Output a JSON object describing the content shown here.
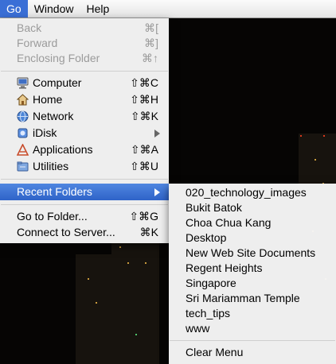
{
  "menubar": {
    "items": [
      {
        "label": "Go"
      },
      {
        "label": "Window"
      },
      {
        "label": "Help"
      }
    ]
  },
  "go_menu": {
    "back": {
      "label": "Back",
      "key": "⌘["
    },
    "forward": {
      "label": "Forward",
      "key": "⌘]"
    },
    "enclosing": {
      "label": "Enclosing Folder",
      "key": "⌘↑"
    },
    "computer": {
      "label": "Computer",
      "key": "⇧⌘C"
    },
    "home": {
      "label": "Home",
      "key": "⇧⌘H"
    },
    "network": {
      "label": "Network",
      "key": "⇧⌘K"
    },
    "idisk": {
      "label": "iDisk"
    },
    "applications": {
      "label": "Applications",
      "key": "⇧⌘A"
    },
    "utilities": {
      "label": "Utilities",
      "key": "⇧⌘U"
    },
    "recent": {
      "label": "Recent Folders"
    },
    "goto": {
      "label": "Go to Folder...",
      "key": "⇧⌘G"
    },
    "connect": {
      "label": "Connect to Server...",
      "key": "⌘K"
    }
  },
  "recent_folders": {
    "items": [
      "020_technology_images",
      "Bukit Batok",
      "Choa Chua Kang",
      "Desktop",
      "New Web Site Documents",
      "Regent Heights",
      "Singapore",
      "Sri Mariamman Temple",
      "tech_tips",
      "www"
    ],
    "clear": "Clear Menu"
  },
  "colors": {
    "highlight": "#3a6fd6",
    "disabled_text": "#9b9b9b",
    "wallpaper": "#060504"
  }
}
